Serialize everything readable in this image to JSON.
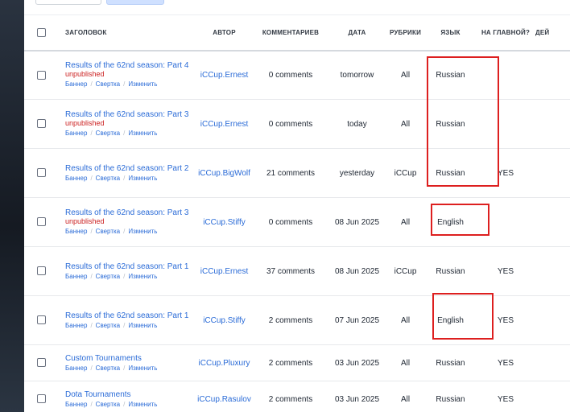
{
  "table": {
    "headers": {
      "title": "ЗАГОЛОВОК",
      "author": "АВТОР",
      "comments": "КОММЕНТАРИЕВ",
      "date": "ДАТА",
      "rubrics": "РУБРИКИ",
      "language": "ЯЗЫК",
      "on_main": "НА ГЛАВНОЙ?",
      "actions": "ДЕЙ"
    },
    "action_labels": {
      "banner": "Баннер",
      "collapse": "Свертка",
      "edit": "Изменить",
      "separator": "/"
    },
    "rows": [
      {
        "title": "Results of the 62nd season: Part 4",
        "status": "unpublished",
        "author": "iCCup.Ernest",
        "comments": "0 comments",
        "date": "tomorrow",
        "rubric": "All",
        "language": "Russian",
        "on_main": ""
      },
      {
        "title": "Results of the 62nd season: Part 3",
        "status": "unpublished",
        "author": "iCCup.Ernest",
        "comments": "0 comments",
        "date": "today",
        "rubric": "All",
        "language": "Russian",
        "on_main": ""
      },
      {
        "title": "Results of the 62nd season: Part 2",
        "status": "",
        "author": "iCCup.BigWolf",
        "comments": "21 comments",
        "date": "yesterday",
        "rubric": "iCCup",
        "language": "Russian",
        "on_main": "YES"
      },
      {
        "title": "Results of the 62nd season: Part 3",
        "status": "unpublished",
        "author": "iCCup.Stiffy",
        "comments": "0 comments",
        "date": "08 Jun 2025",
        "rubric": "All",
        "language": "English",
        "on_main": ""
      },
      {
        "title": "Results of the 62nd season: Part 1",
        "status": "",
        "author": "iCCup.Ernest",
        "comments": "37 comments",
        "date": "08 Jun 2025",
        "rubric": "iCCup",
        "language": "Russian",
        "on_main": "YES"
      },
      {
        "title": "Results of the 62nd season: Part 1",
        "status": "",
        "author": "iCCup.Stiffy",
        "comments": "2 comments",
        "date": "07 Jun 2025",
        "rubric": "All",
        "language": "English",
        "on_main": "YES"
      },
      {
        "title": "Custom Tournaments",
        "status": "",
        "author": "iCCup.Pluxury",
        "comments": "2 comments",
        "date": "03 Jun 2025",
        "rubric": "All",
        "language": "Russian",
        "on_main": "YES"
      },
      {
        "title": "Dota Tournaments",
        "status": "",
        "author": "iCCup.Rasulov",
        "comments": "2 comments",
        "date": "03 Jun 2025",
        "rubric": "All",
        "language": "Russian",
        "on_main": "YES"
      }
    ]
  },
  "colors": {
    "link": "#2a6bd7",
    "unpublished": "#cc2222",
    "highlight_box": "#dd1f1f"
  }
}
